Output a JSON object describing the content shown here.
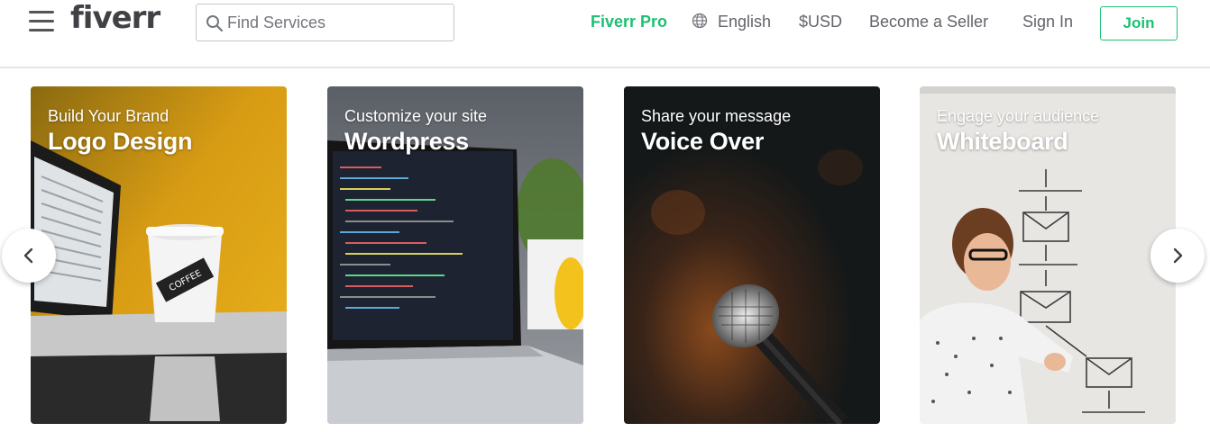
{
  "header": {
    "logo": "fiverr",
    "search_placeholder": "Find Services",
    "nav": {
      "pro": "Fiverr Pro",
      "language": "English",
      "currency": "$USD",
      "become_seller": "Become a Seller",
      "sign_in": "Sign In",
      "join": "Join"
    }
  },
  "cards": [
    {
      "subtitle": "Build Your Brand",
      "title": "Logo Design"
    },
    {
      "subtitle": "Customize your site",
      "title": "Wordpress"
    },
    {
      "subtitle": "Share your message",
      "title": "Voice Over"
    },
    {
      "subtitle": "Engage your audience",
      "title": "Whiteboard"
    }
  ],
  "colors": {
    "brand_green": "#1dbf73",
    "text_gray": "#62646a"
  },
  "icons": {
    "menu": "hamburger-menu-icon",
    "search": "search-icon",
    "language": "globe-icon",
    "prev": "chevron-left-icon",
    "next": "chevron-right-icon"
  }
}
